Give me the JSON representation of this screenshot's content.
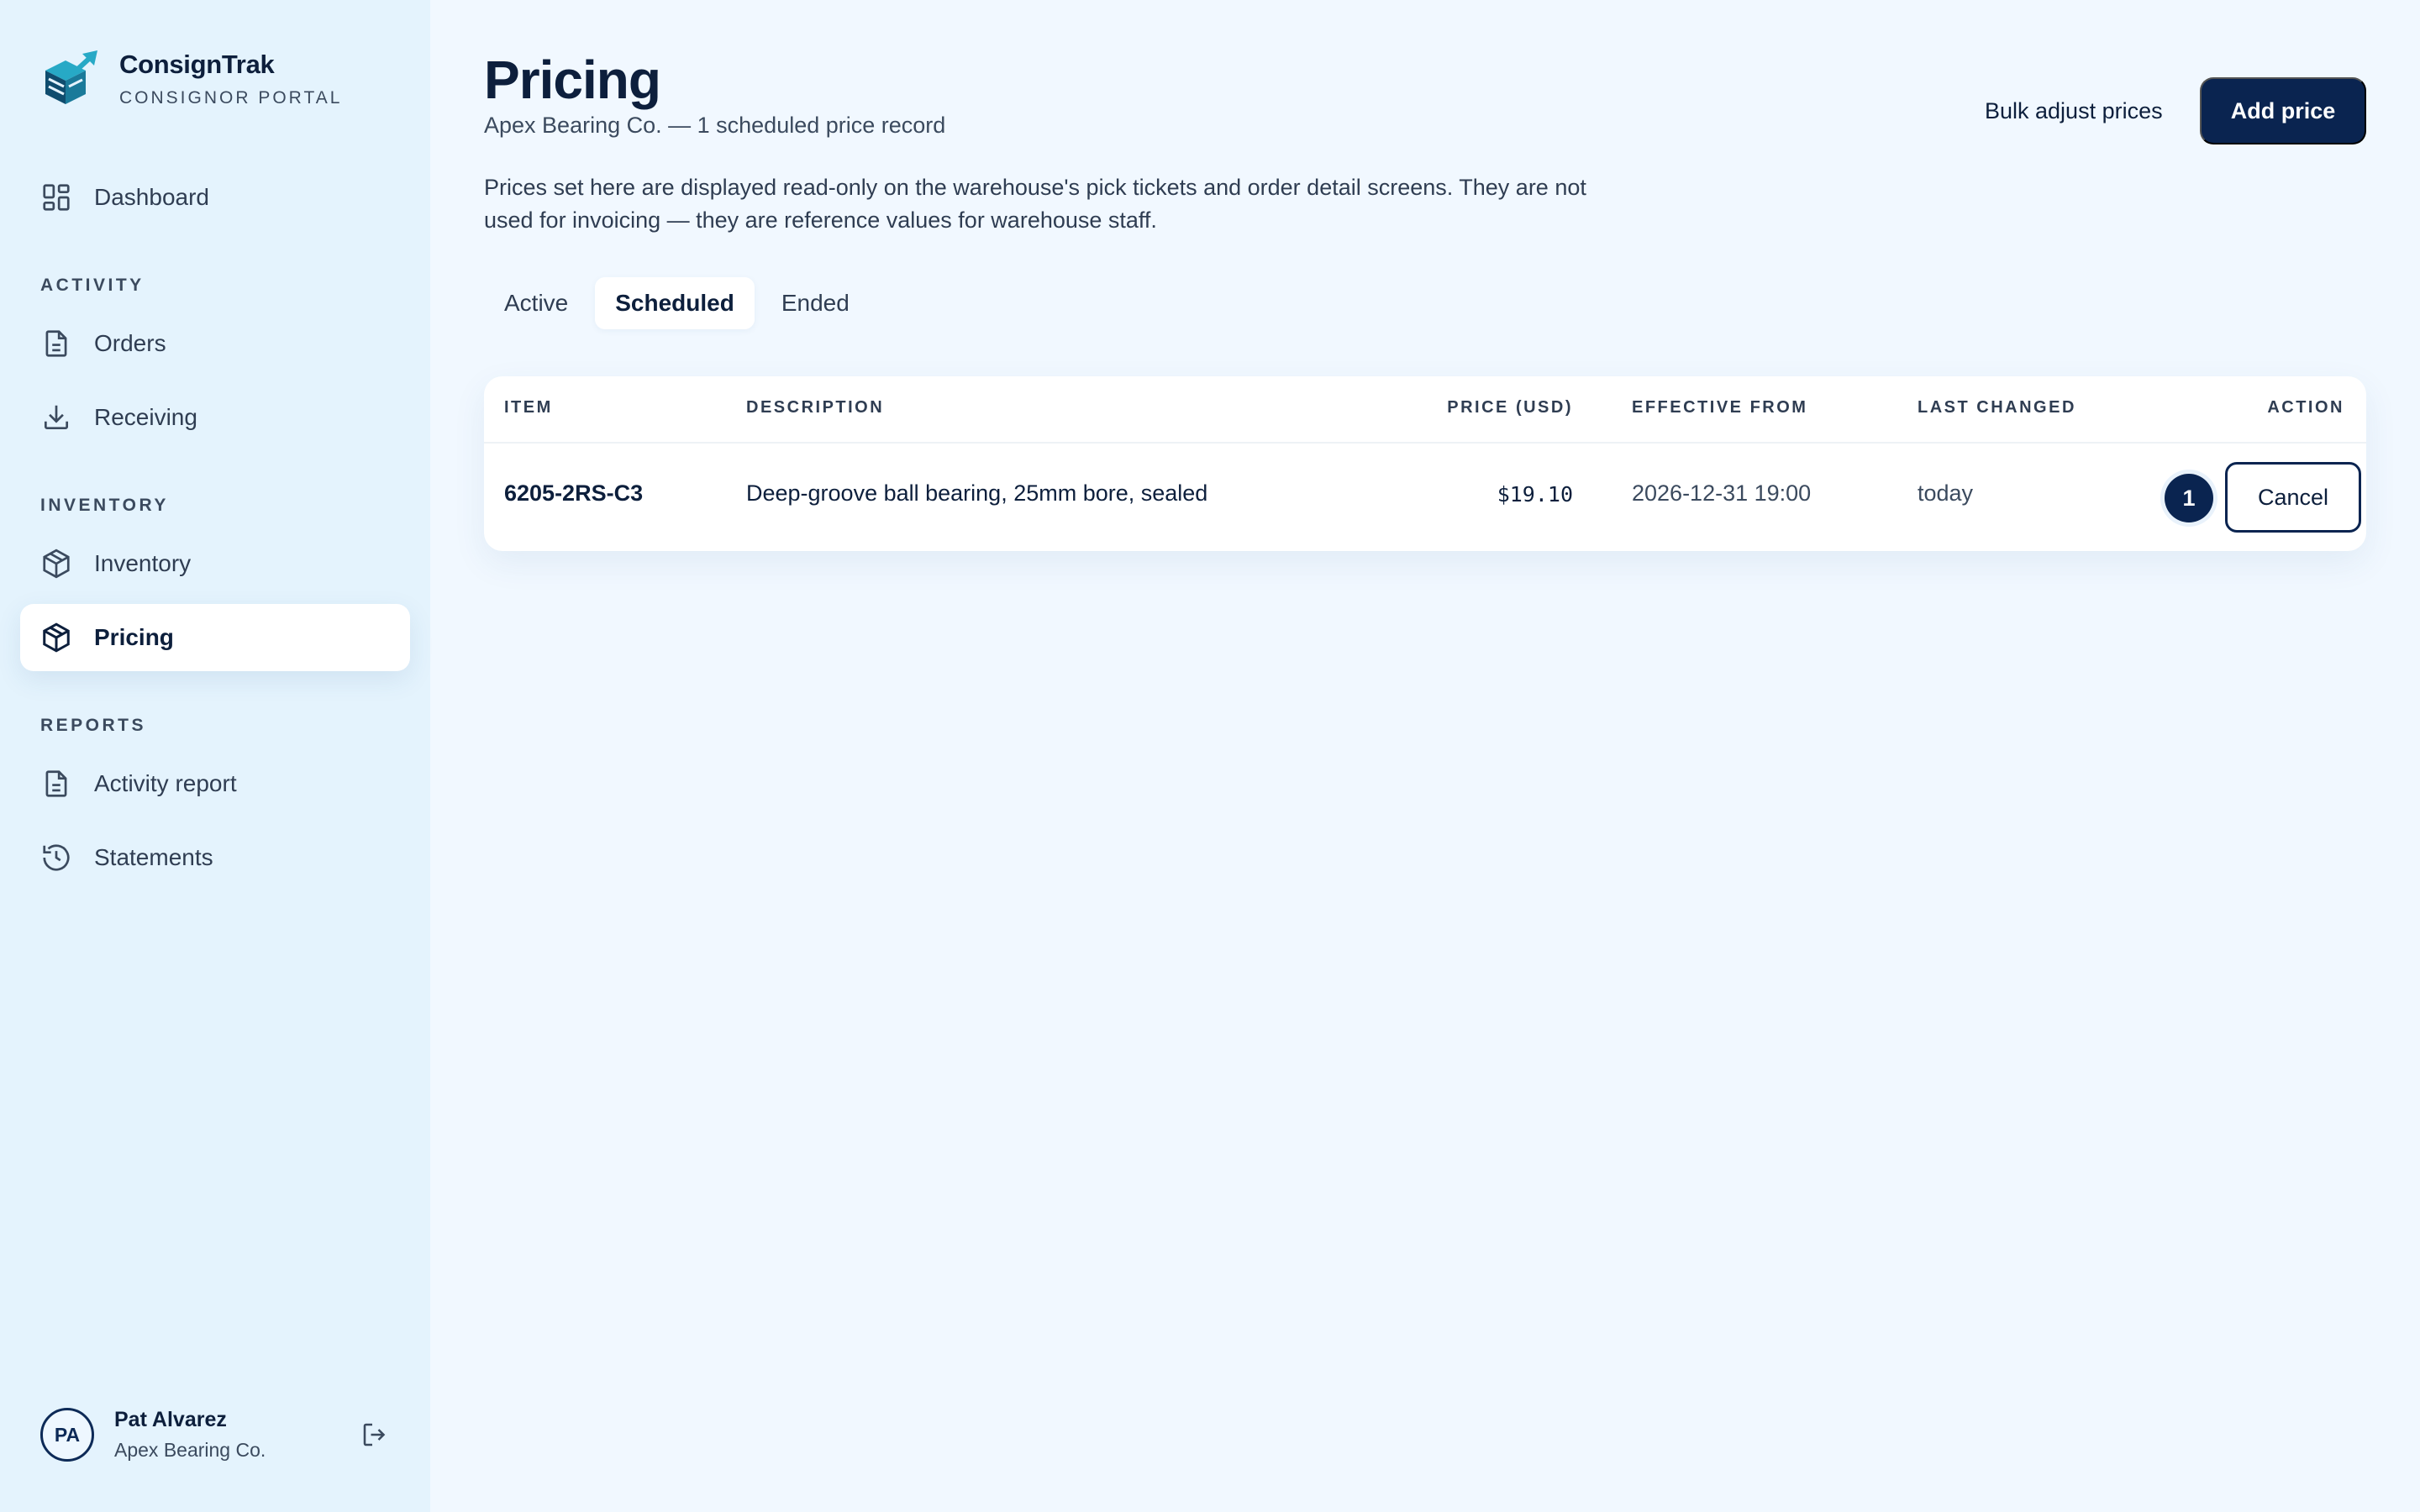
{
  "brand": {
    "name": "ConsignTrak",
    "subtitle": "CONSIGNOR PORTAL",
    "logo_icon": "cube-arrow-logo",
    "colors": {
      "logo_dark": "#0f4c6e",
      "logo_light": "#27a9c6"
    }
  },
  "sidebar": {
    "dashboard": {
      "label": "Dashboard",
      "icon": "grid-icon"
    },
    "sections": {
      "activity": "ACTIVITY",
      "inventory": "INVENTORY",
      "reports": "REPORTS"
    },
    "items": {
      "orders": {
        "label": "Orders",
        "icon": "document-icon"
      },
      "receiving": {
        "label": "Receiving",
        "icon": "download-icon"
      },
      "inventory": {
        "label": "Inventory",
        "icon": "box-icon"
      },
      "pricing": {
        "label": "Pricing",
        "icon": "box-icon",
        "active": true
      },
      "activity_report": {
        "label": "Activity report",
        "icon": "document-icon"
      },
      "statements": {
        "label": "Statements",
        "icon": "history-icon"
      }
    }
  },
  "user": {
    "initials": "PA",
    "name": "Pat Alvarez",
    "org": "Apex Bearing Co.",
    "logout_icon": "logout-icon"
  },
  "header": {
    "title": "Pricing",
    "subtitle": "Apex Bearing Co. — 1 scheduled price record",
    "note": "Prices set here are displayed read-only on the warehouse's pick tickets and order detail screens. They are not used for invoicing — they are reference values for warehouse staff.",
    "bulk_button": "Bulk adjust prices",
    "add_button": "Add price"
  },
  "tabs": [
    {
      "label": "Active",
      "active": false
    },
    {
      "label": "Scheduled",
      "active": true
    },
    {
      "label": "Ended",
      "active": false
    }
  ],
  "table": {
    "columns": {
      "item": "ITEM",
      "description": "DESCRIPTION",
      "price": "PRICE (USD)",
      "effective_from": "EFFECTIVE FROM",
      "last_changed": "LAST CHANGED",
      "action": "ACTION"
    },
    "rows": [
      {
        "item": "6205-2RS-C3",
        "description": "Deep-groove ball bearing, 25mm bore, sealed",
        "price": "$19.10",
        "effective_from": "2026-12-31 19:00",
        "last_changed": "today",
        "badge": "1",
        "action_label": "Cancel"
      }
    ]
  },
  "colors": {
    "sidebar_bg": "#e4f3fd",
    "main_bg": "#f1f8ff",
    "primary": "#0a2450",
    "text": "#0d1f3c"
  }
}
